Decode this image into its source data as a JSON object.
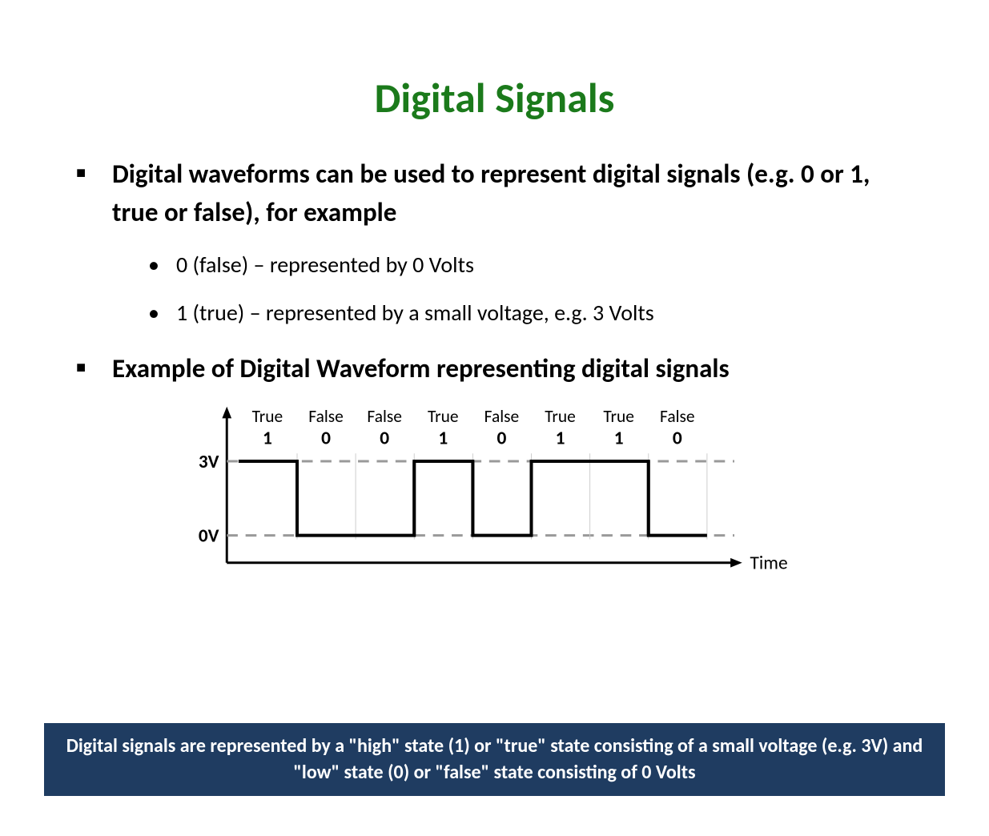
{
  "title": "Digital Signals",
  "bullets": {
    "item1": "Digital waveforms can be used to represent digital signals (e.g. 0 or 1, true or false), for example",
    "sub1": "0 (false) – represented by 0 Volts",
    "sub2": "1 (true) – represented by a small voltage, e.g. 3 Volts",
    "item2": "Example of Digital Waveform representing digital signals"
  },
  "footer": "Digital signals are represented by a \"high\" state (1) or \"true\" state consisting of a small voltage (e.g. 3V) and \"low\" state (0) or \"false\" state consisting of 0 Volts",
  "chart_data": {
    "type": "line",
    "title": "",
    "xlabel": "Time",
    "ylabel": "",
    "ylevels": [
      "3V",
      "0V"
    ],
    "bit_labels_top": [
      "True",
      "False",
      "False",
      "True",
      "False",
      "True",
      "True",
      "False"
    ],
    "bit_values": [
      "1",
      "0",
      "0",
      "1",
      "0",
      "1",
      "1",
      "0"
    ],
    "bits_numeric": [
      1,
      0,
      0,
      1,
      0,
      1,
      1,
      0
    ]
  }
}
